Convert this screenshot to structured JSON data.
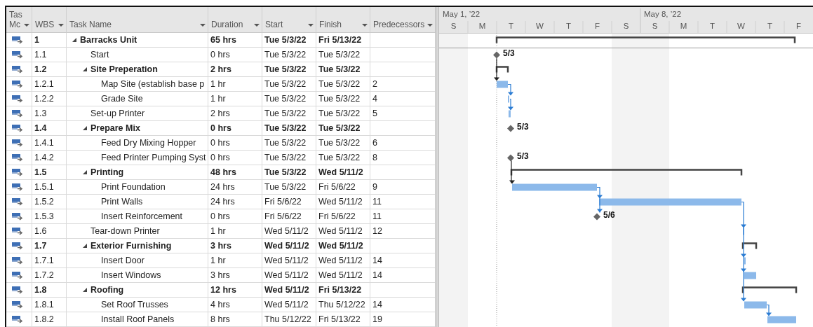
{
  "columns": [
    {
      "label": "Tas Mc"
    },
    {
      "label": "WBS"
    },
    {
      "label": "Task Name"
    },
    {
      "label": "Duration"
    },
    {
      "label": "Start"
    },
    {
      "label": "Finish"
    },
    {
      "label": "Predecessors"
    }
  ],
  "timescale": {
    "weeks": [
      {
        "label": "May 1, ’22",
        "days": [
          {
            "label": "S",
            "nonworking": true
          },
          {
            "label": "M",
            "nonworking": false
          },
          {
            "label": "T",
            "nonworking": false
          },
          {
            "label": "W",
            "nonworking": false
          },
          {
            "label": "T",
            "nonworking": false
          },
          {
            "label": "F",
            "nonworking": false
          },
          {
            "label": "S",
            "nonworking": true
          }
        ]
      },
      {
        "label": "May 8, ’22",
        "days": [
          {
            "label": "S",
            "nonworking": true
          },
          {
            "label": "M",
            "nonworking": false
          },
          {
            "label": "T",
            "nonworking": false
          },
          {
            "label": "W",
            "nonworking": false
          },
          {
            "label": "T",
            "nonworking": false
          },
          {
            "label": "F",
            "nonworking": false
          }
        ]
      }
    ]
  },
  "tasks": [
    {
      "wbs": "1",
      "name": "Barracks Unit",
      "duration": "65 hrs",
      "start": "Tue 5/3/22",
      "finish": "Fri 5/13/22",
      "kind": "summary",
      "expanded": true,
      "children": [
        {
          "wbs": "1.1",
          "name": "Start",
          "duration": "0 hrs",
          "start": "Tue 5/3/22",
          "finish": "Tue 5/3/22",
          "kind": "task",
          "bar_label": "5/3"
        },
        {
          "wbs": "1.2",
          "name": "Site Preperation",
          "duration": "2 hrs",
          "start": "Tue 5/3/22",
          "finish": "Tue 5/3/22",
          "kind": "summary",
          "expanded": true,
          "children": [
            {
              "wbs": "1.2.1",
              "name": "Map Site (establish base p",
              "duration": "1 hr",
              "start": "Tue 5/3/22",
              "finish": "Tue 5/3/22",
              "predecessors": "2",
              "kind": "task"
            },
            {
              "wbs": "1.2.2",
              "name": "Grade Site",
              "duration": "1 hr",
              "start": "Tue 5/3/22",
              "finish": "Tue 5/3/22",
              "predecessors": "4",
              "kind": "task"
            }
          ]
        },
        {
          "wbs": "1.3",
          "name": "Set-up Printer",
          "duration": "2 hrs",
          "start": "Tue 5/3/22",
          "finish": "Tue 5/3/22",
          "predecessors": "5",
          "kind": "task"
        },
        {
          "wbs": "1.4",
          "name": "Prepare Mix",
          "duration": "0 hrs",
          "start": "Tue 5/3/22",
          "finish": "Tue 5/3/22",
          "kind": "summary",
          "expanded": true,
          "bar_label": "5/3",
          "children": [
            {
              "wbs": "1.4.1",
              "name": "Feed Dry Mixing Hopper",
              "duration": "0 hrs",
              "start": "Tue 5/3/22",
              "finish": "Tue 5/3/22",
              "predecessors": "6",
              "kind": "task"
            },
            {
              "wbs": "1.4.2",
              "name": "Feed Printer Pumping Syst",
              "duration": "0 hrs",
              "start": "Tue 5/3/22",
              "finish": "Tue 5/3/22",
              "predecessors": "8",
              "kind": "task",
              "bar_label": "5/3"
            }
          ]
        },
        {
          "wbs": "1.5",
          "name": "Printing",
          "duration": "48 hrs",
          "start": "Tue 5/3/22",
          "finish": "Wed 5/11/2",
          "kind": "summary",
          "expanded": true,
          "children": [
            {
              "wbs": "1.5.1",
              "name": "Print Foundation",
              "duration": "24 hrs",
              "start": "Tue 5/3/22",
              "finish": "Fri 5/6/22",
              "predecessors": "9",
              "kind": "task"
            },
            {
              "wbs": "1.5.2",
              "name": "Print Walls",
              "duration": "24 hrs",
              "start": "Fri 5/6/22",
              "finish": "Wed 5/11/2",
              "predecessors": "11",
              "kind": "task"
            },
            {
              "wbs": "1.5.3",
              "name": "Insert Reinforcement",
              "duration": "0 hrs",
              "start": "Fri 5/6/22",
              "finish": "Fri 5/6/22",
              "predecessors": "11",
              "kind": "task",
              "bar_label": "5/6"
            }
          ]
        },
        {
          "wbs": "1.6",
          "name": "Tear-down Printer",
          "duration": "1 hr",
          "start": "Wed 5/11/2",
          "finish": "Wed 5/11/2",
          "predecessors": "12",
          "kind": "task"
        },
        {
          "wbs": "1.7",
          "name": "Exterior Furnishing",
          "duration": "3 hrs",
          "start": "Wed 5/11/2",
          "finish": "Wed 5/11/2",
          "kind": "summary",
          "expanded": true,
          "children": [
            {
              "wbs": "1.7.1",
              "name": "Insert Door",
              "duration": "1 hr",
              "start": "Wed 5/11/2",
              "finish": "Wed 5/11/2",
              "predecessors": "14",
              "kind": "task"
            },
            {
              "wbs": "1.7.2",
              "name": "Insert Windows",
              "duration": "3 hrs",
              "start": "Wed 5/11/2",
              "finish": "Wed 5/11/2",
              "predecessors": "14",
              "kind": "task"
            }
          ]
        },
        {
          "wbs": "1.8",
          "name": "Roofing",
          "duration": "12 hrs",
          "start": "Wed 5/11/2",
          "finish": "Fri 5/13/22",
          "kind": "summary",
          "expanded": true,
          "children": [
            {
              "wbs": "1.8.1",
              "name": "Set Roof Trusses",
              "duration": "4 hrs",
              "start": "Wed 5/11/2",
              "finish": "Thu 5/12/22",
              "predecessors": "14",
              "kind": "task"
            },
            {
              "wbs": "1.8.2",
              "name": "Install Roof Panels",
              "duration": "8 hrs",
              "start": "Thu 5/12/22",
              "finish": "Fri 5/13/22",
              "predecessors": "19",
              "kind": "task"
            }
          ]
        }
      ]
    }
  ]
}
